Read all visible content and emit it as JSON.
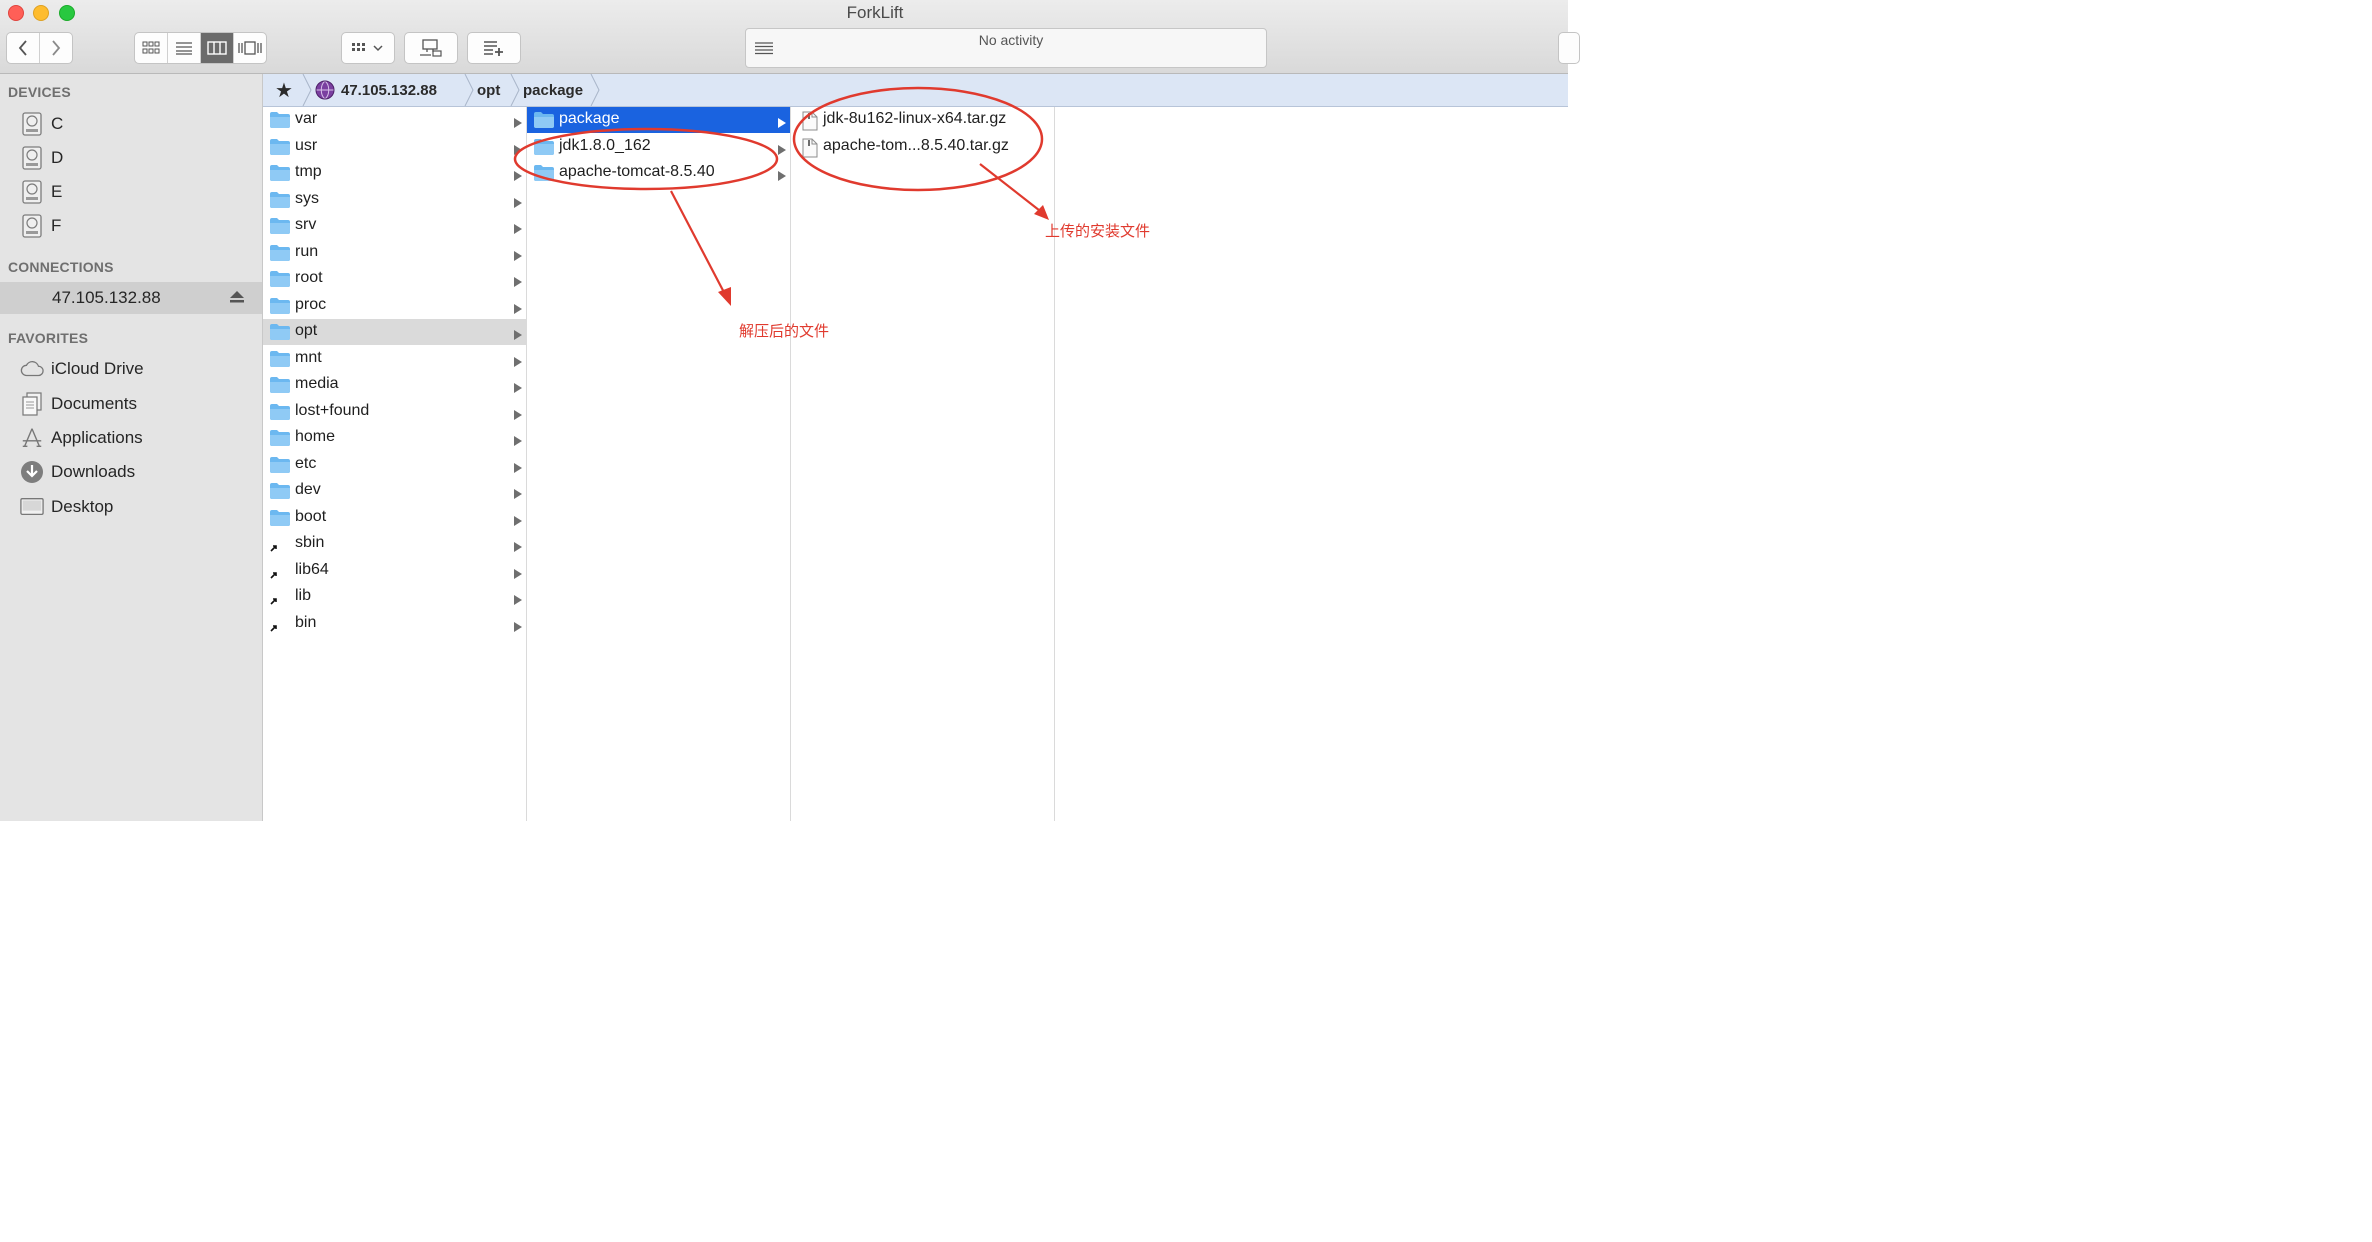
{
  "window": {
    "title": "ForkLift"
  },
  "toolbar": {
    "activity_text": "No activity"
  },
  "sidebar": {
    "devices_header": "DEVICES",
    "devices": [
      {
        "label": "C"
      },
      {
        "label": "D"
      },
      {
        "label": "E"
      },
      {
        "label": "F"
      }
    ],
    "connections_header": "CONNECTIONS",
    "connection": {
      "label": "47.105.132.88"
    },
    "favorites_header": "FAVORITES",
    "favorites": [
      {
        "label": "iCloud Drive",
        "icon": "cloud-icon"
      },
      {
        "label": "Documents",
        "icon": "documents-icon"
      },
      {
        "label": "Applications",
        "icon": "applications-icon"
      },
      {
        "label": "Downloads",
        "icon": "download-icon"
      },
      {
        "label": "Desktop",
        "icon": "desktop-icon"
      }
    ]
  },
  "path": {
    "favorite_symbol": "★",
    "crumbs": [
      "47.105.132.88",
      "opt",
      "package"
    ]
  },
  "columns": {
    "root": [
      {
        "name": "var",
        "type": "folder"
      },
      {
        "name": "usr",
        "type": "folder"
      },
      {
        "name": "tmp",
        "type": "folder"
      },
      {
        "name": "sys",
        "type": "folder"
      },
      {
        "name": "srv",
        "type": "folder"
      },
      {
        "name": "run",
        "type": "folder"
      },
      {
        "name": "root",
        "type": "folder"
      },
      {
        "name": "proc",
        "type": "folder"
      },
      {
        "name": "opt",
        "type": "folder"
      },
      {
        "name": "mnt",
        "type": "folder"
      },
      {
        "name": "media",
        "type": "folder"
      },
      {
        "name": "lost+found",
        "type": "folder"
      },
      {
        "name": "home",
        "type": "folder"
      },
      {
        "name": "etc",
        "type": "folder"
      },
      {
        "name": "dev",
        "type": "folder"
      },
      {
        "name": "boot",
        "type": "folder"
      },
      {
        "name": "sbin",
        "type": "alias"
      },
      {
        "name": "lib64",
        "type": "alias"
      },
      {
        "name": "lib",
        "type": "alias"
      },
      {
        "name": "bin",
        "type": "alias"
      }
    ],
    "opt": [
      {
        "name": "package",
        "type": "folder"
      },
      {
        "name": "jdk1.8.0_162",
        "type": "folder"
      },
      {
        "name": "apache-tomcat-8.5.40",
        "type": "folder"
      }
    ],
    "package": [
      {
        "name": "jdk-8u162-linux-x64.tar.gz",
        "type": "file"
      },
      {
        "name": "apache-tom...8.5.40.tar.gz",
        "type": "file"
      }
    ]
  },
  "annotations": {
    "extracted_label": "解压后的文件",
    "uploaded_label": "上传的安装文件",
    "color": "#e03a2e"
  },
  "colors": {
    "selection": "#1a63e0",
    "folder": "#6cb8f0",
    "pathbar": "#dce6f5"
  }
}
